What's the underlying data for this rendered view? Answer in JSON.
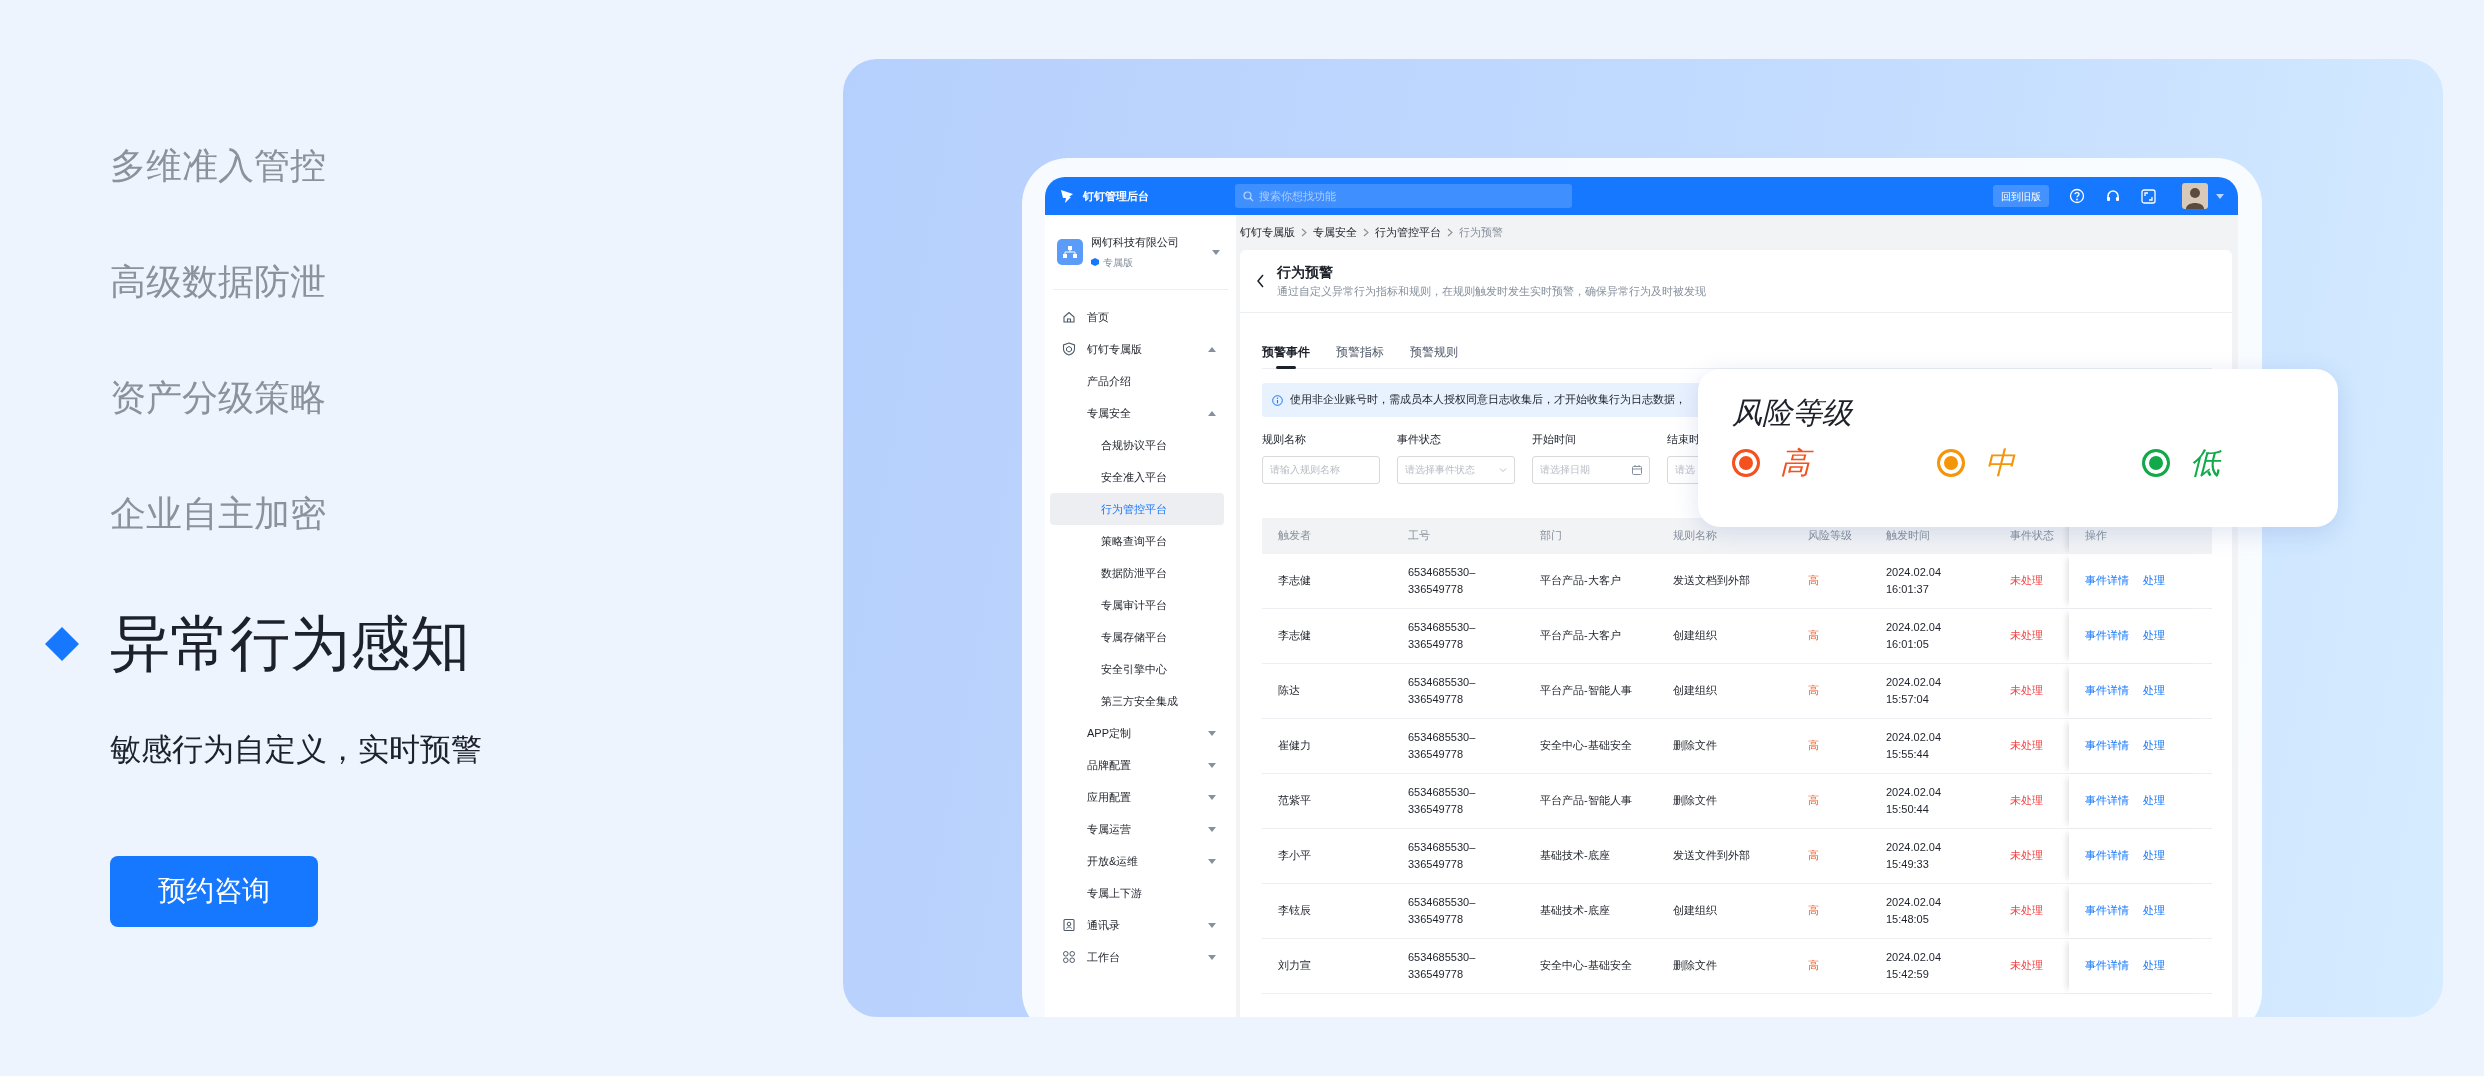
{
  "features": [
    {
      "label": "多维准入管控",
      "selected": false
    },
    {
      "label": "高级数据防泄",
      "selected": false
    },
    {
      "label": "资产分级策略",
      "selected": false
    },
    {
      "label": "企业自主加密",
      "selected": false
    },
    {
      "label": "异常行为感知",
      "selected": true
    }
  ],
  "subtitle": "敏感行为自定义，实时预警",
  "cta_button": "预约咨询",
  "app": {
    "brand": "钉钉管理后台",
    "search_placeholder": "搜索你想找功能",
    "old_version_button": "回到旧版",
    "company": {
      "name": "网钉科技有限公司",
      "edition": "专属版"
    },
    "sidebar": {
      "items": [
        {
          "label": "首页",
          "selected": false
        },
        {
          "label": "钉钉专属版",
          "selected": false,
          "expanded": true,
          "children": [
            {
              "label": "产品介绍",
              "selected": false
            },
            {
              "label": "专属安全",
              "selected": false,
              "expanded": true,
              "children": [
                {
                  "label": "合规协议平台",
                  "selected": false
                },
                {
                  "label": "安全准入平台",
                  "selected": false
                },
                {
                  "label": "行为管控平台",
                  "selected": true
                },
                {
                  "label": "策略查询平台",
                  "selected": false
                },
                {
                  "label": "数据防泄平台",
                  "selected": false
                },
                {
                  "label": "专属审计平台",
                  "selected": false
                },
                {
                  "label": "专属存储平台",
                  "selected": false
                },
                {
                  "label": "安全引擎中心",
                  "selected": false
                },
                {
                  "label": "第三方安全集成",
                  "selected": false
                }
              ]
            },
            {
              "label": "APP定制",
              "selected": false,
              "expanded": false
            },
            {
              "label": "品牌配置",
              "selected": false,
              "expanded": false
            },
            {
              "label": "应用配置",
              "selected": false,
              "expanded": false
            },
            {
              "label": "专属运营",
              "selected": false,
              "expanded": false
            },
            {
              "label": "开放&运维",
              "selected": false,
              "expanded": false
            },
            {
              "label": "专属上下游",
              "selected": false
            }
          ]
        },
        {
          "label": "通讯录",
          "selected": false,
          "expanded": false
        },
        {
          "label": "工作台",
          "selected": false,
          "expanded": false
        }
      ]
    },
    "breadcrumb": [
      "钉钉专属版",
      "专属安全",
      "行为管控平台",
      "行为预警"
    ],
    "page": {
      "title": "行为预警",
      "description": "通过自定义异常行为指标和规则，在规则触发时发生实时预警，确保异常行为及时被发现",
      "tabs": [
        {
          "label": "预警事件",
          "selected": true
        },
        {
          "label": "预警指标",
          "selected": false
        },
        {
          "label": "预警规则",
          "selected": false
        }
      ],
      "notice": "使用非企业账号时，需成员本人授权同意日志收集后，才开始收集行为日志数据，",
      "filters": [
        {
          "label": "规则名称",
          "placeholder": "请输入规则名称",
          "kind": "text"
        },
        {
          "label": "事件状态",
          "placeholder": "请选择事件状态",
          "kind": "select"
        },
        {
          "label": "开始时间",
          "placeholder": "请选择日期",
          "kind": "date"
        },
        {
          "label": "结束时",
          "placeholder": "请选",
          "kind": "text"
        }
      ],
      "table": {
        "columns": [
          {
            "label": "触发者",
            "kind": "text"
          },
          {
            "label": "工号",
            "kind": "wrap"
          },
          {
            "label": "部门",
            "kind": "text"
          },
          {
            "label": "规则名称",
            "kind": "text"
          },
          {
            "label": "风险等级",
            "kind": "risk"
          },
          {
            "label": "触发时间",
            "kind": "wrap"
          },
          {
            "label": "事件状态",
            "kind": "status"
          },
          {
            "label": "操作",
            "kind": "actions"
          }
        ],
        "rows": [
          {
            "cells": [
              "李志健",
              "6534685530–336549778",
              "平台产品-大客户",
              "发送文档到外部",
              "高",
              "2024.02.04 16:01:37",
              "未处理"
            ],
            "actions": [
              "事件详情",
              "处理"
            ]
          },
          {
            "cells": [
              "李志健",
              "6534685530–336549778",
              "平台产品-大客户",
              "创建组织",
              "高",
              "2024.02.04 16:01:05",
              "未处理"
            ],
            "actions": [
              "事件详情",
              "处理"
            ]
          },
          {
            "cells": [
              "陈达",
              "6534685530–336549778",
              "平台产品-智能人事",
              "创建组织",
              "高",
              "2024.02.04 15:57:04",
              "未处理"
            ],
            "actions": [
              "事件详情",
              "处理"
            ]
          },
          {
            "cells": [
              "崔健力",
              "6534685530–336549778",
              "安全中心-基础安全",
              "删除文件",
              "高",
              "2024.02.04 15:55:44",
              "未处理"
            ],
            "actions": [
              "事件详情",
              "处理"
            ]
          },
          {
            "cells": [
              "范紫平",
              "6534685530–336549778",
              "平台产品-智能人事",
              "删除文件",
              "高",
              "2024.02.04 15:50:44",
              "未处理"
            ],
            "actions": [
              "事件详情",
              "处理"
            ]
          },
          {
            "cells": [
              "李小平",
              "6534685530–336549778",
              "基础技术-底座",
              "发送文件到外部",
              "高",
              "2024.02.04 15:49:33",
              "未处理"
            ],
            "actions": [
              "事件详情",
              "处理"
            ]
          },
          {
            "cells": [
              "李铉辰",
              "6534685530–336549778",
              "基础技术-底座",
              "创建组织",
              "高",
              "2024.02.04 15:48:05",
              "未处理"
            ],
            "actions": [
              "事件详情",
              "处理"
            ]
          },
          {
            "cells": [
              "刘力宣",
              "6534685530–336549778",
              "安全中心-基础安全",
              "删除文件",
              "高",
              "2024.02.04 15:42:59",
              "未处理"
            ],
            "actions": [
              "事件详情",
              "处理"
            ]
          }
        ]
      }
    }
  },
  "risk_popup": {
    "title": "风险等级",
    "levels": [
      {
        "label": "高",
        "color": "#f4511e"
      },
      {
        "label": "中",
        "color": "#f5950a"
      },
      {
        "label": "低",
        "color": "#12a94a"
      }
    ]
  }
}
